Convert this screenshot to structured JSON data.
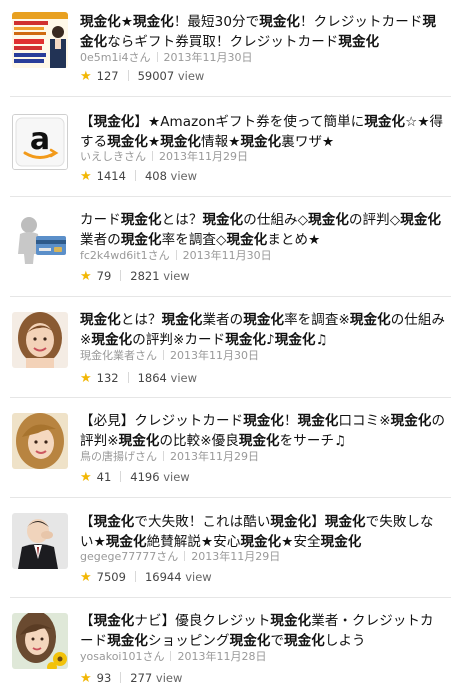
{
  "items": [
    {
      "thumb": "flyer-thumbnail",
      "title_parts": [
        [
          "現金化",
          1
        ],
        [
          "★",
          0
        ],
        [
          "現金化",
          1
        ],
        [
          "！最短30分で",
          0
        ],
        [
          "現金化",
          1
        ],
        [
          "！クレジットカード",
          0
        ],
        [
          "現金化",
          1
        ],
        [
          "ならギフト券買取！クレジットカード",
          0
        ],
        [
          "現金化",
          1
        ]
      ],
      "author": "0e5m1i4さん",
      "date": "2013年11月30日",
      "likes": "127",
      "views": "59007",
      "views_unit": "view"
    },
    {
      "thumb": "amazon-logo",
      "title_parts": [
        [
          "【",
          0
        ],
        [
          "現金化",
          1
        ],
        [
          "】★Amazonギフト券を使って簡単に",
          0
        ],
        [
          "現金化",
          1
        ],
        [
          "☆★得する",
          0
        ],
        [
          "現金化",
          1
        ],
        [
          "★",
          0
        ],
        [
          "現金化",
          1
        ],
        [
          "情報★",
          0
        ],
        [
          "現金化",
          1
        ],
        [
          "裏ワザ★",
          0
        ]
      ],
      "author": "いえしきさん",
      "date": "2013年11月29日",
      "likes": "1414",
      "views": "408",
      "views_unit": "view"
    },
    {
      "thumb": "figure-with-card",
      "title_parts": [
        [
          "カード",
          0
        ],
        [
          "現金化",
          1
        ],
        [
          "とは？",
          0
        ],
        [
          "現金化",
          1
        ],
        [
          "の仕組み◇",
          0
        ],
        [
          "現金化",
          1
        ],
        [
          "の評判◇",
          0
        ],
        [
          "現金化",
          1
        ],
        [
          "業者の",
          0
        ],
        [
          "現金化",
          1
        ],
        [
          "率を調査◇",
          0
        ],
        [
          "現金化",
          1
        ],
        [
          "まとめ★",
          0
        ]
      ],
      "author": "fc2k4wd6it1さん",
      "date": "2013年11月30日",
      "likes": "79",
      "views": "2821",
      "views_unit": "view"
    },
    {
      "thumb": "woman-portrait",
      "title_parts": [
        [
          "現金化",
          1
        ],
        [
          "とは？",
          0
        ],
        [
          "現金化",
          1
        ],
        [
          "業者の",
          0
        ],
        [
          "現金化",
          1
        ],
        [
          "率を調査※",
          0
        ],
        [
          "現金化",
          1
        ],
        [
          "の仕組み※",
          0
        ],
        [
          "現金化",
          1
        ],
        [
          "の評判※カード",
          0
        ],
        [
          "現金化",
          1
        ],
        [
          "♪",
          0
        ],
        [
          "現金化",
          1
        ],
        [
          "♫",
          0
        ]
      ],
      "author": "現金化業者さん",
      "date": "2013年11月30日",
      "likes": "132",
      "views": "1864",
      "views_unit": "view"
    },
    {
      "thumb": "woman-portrait-2",
      "title_parts": [
        [
          "【必見】クレジットカード",
          0
        ],
        [
          "現金化",
          1
        ],
        [
          "！",
          0
        ],
        [
          "現金化",
          1
        ],
        [
          "口コミ※",
          0
        ],
        [
          "現金化",
          1
        ],
        [
          "の評判※",
          0
        ],
        [
          "現金化",
          1
        ],
        [
          "の比較※優良",
          0
        ],
        [
          "現金化",
          1
        ],
        [
          "をサーチ♫",
          0
        ]
      ],
      "author": "鳥の唐揚げさん",
      "date": "2013年11月29日",
      "likes": "41",
      "views": "4196",
      "views_unit": "view"
    },
    {
      "thumb": "businessman-photo",
      "title_parts": [
        [
          "【",
          0
        ],
        [
          "現金化",
          1
        ],
        [
          "で大失敗！これは酷い",
          0
        ],
        [
          "現金化",
          1
        ],
        [
          "】",
          0
        ],
        [
          "現金化",
          1
        ],
        [
          "で失敗しない★",
          0
        ],
        [
          "現金化",
          1
        ],
        [
          "絶賛解説★安心",
          0
        ],
        [
          "現金化",
          1
        ],
        [
          "★安全",
          0
        ],
        [
          "現金化",
          1
        ]
      ],
      "author": "gegege77777さん",
      "date": "2013年11月29日",
      "likes": "7509",
      "views": "16944",
      "views_unit": "view"
    },
    {
      "thumb": "woman-with-sunflowers",
      "title_parts": [
        [
          "【",
          0
        ],
        [
          "現金化",
          1
        ],
        [
          "ナビ】優良クレジット",
          0
        ],
        [
          "現金化",
          1
        ],
        [
          "業者・クレジットカード",
          0
        ],
        [
          "現金化",
          1
        ],
        [
          "ショッピング",
          0
        ],
        [
          "現金化",
          1
        ],
        [
          "で",
          0
        ],
        [
          "現金化",
          1
        ],
        [
          "しよう",
          0
        ]
      ],
      "author": "yosakoi101さん",
      "date": "2013年11月28日",
      "likes": "93",
      "views": "277",
      "views_unit": "view"
    }
  ]
}
